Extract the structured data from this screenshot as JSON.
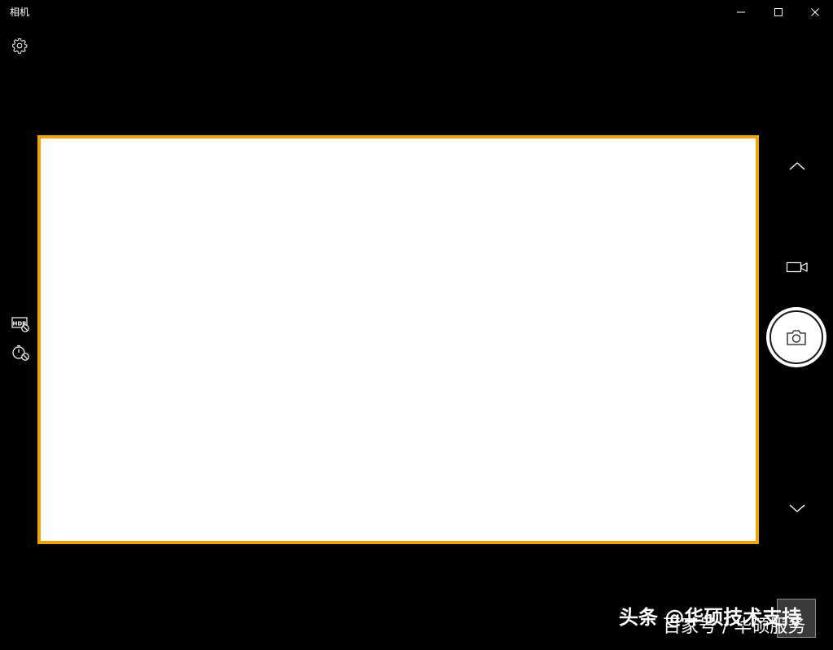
{
  "window": {
    "title": "相机"
  },
  "colors": {
    "background": "#000000",
    "preview_border": "#f0a30a",
    "preview_fill": "#ffffff",
    "icon": "#ffffff"
  },
  "icons": {
    "minimize": "minimize-icon",
    "maximize": "maximize-icon",
    "close": "close-icon",
    "settings": "gear-icon",
    "hdr": "hdr-off-icon",
    "timer": "timer-off-icon",
    "chevron_up": "chevron-up-icon",
    "video": "video-camera-icon",
    "photo": "camera-icon",
    "chevron_down": "chevron-down-icon"
  },
  "watermark": {
    "primary": "头条 @华硕技术支持",
    "secondary": "百家号 / 华硕服务"
  }
}
